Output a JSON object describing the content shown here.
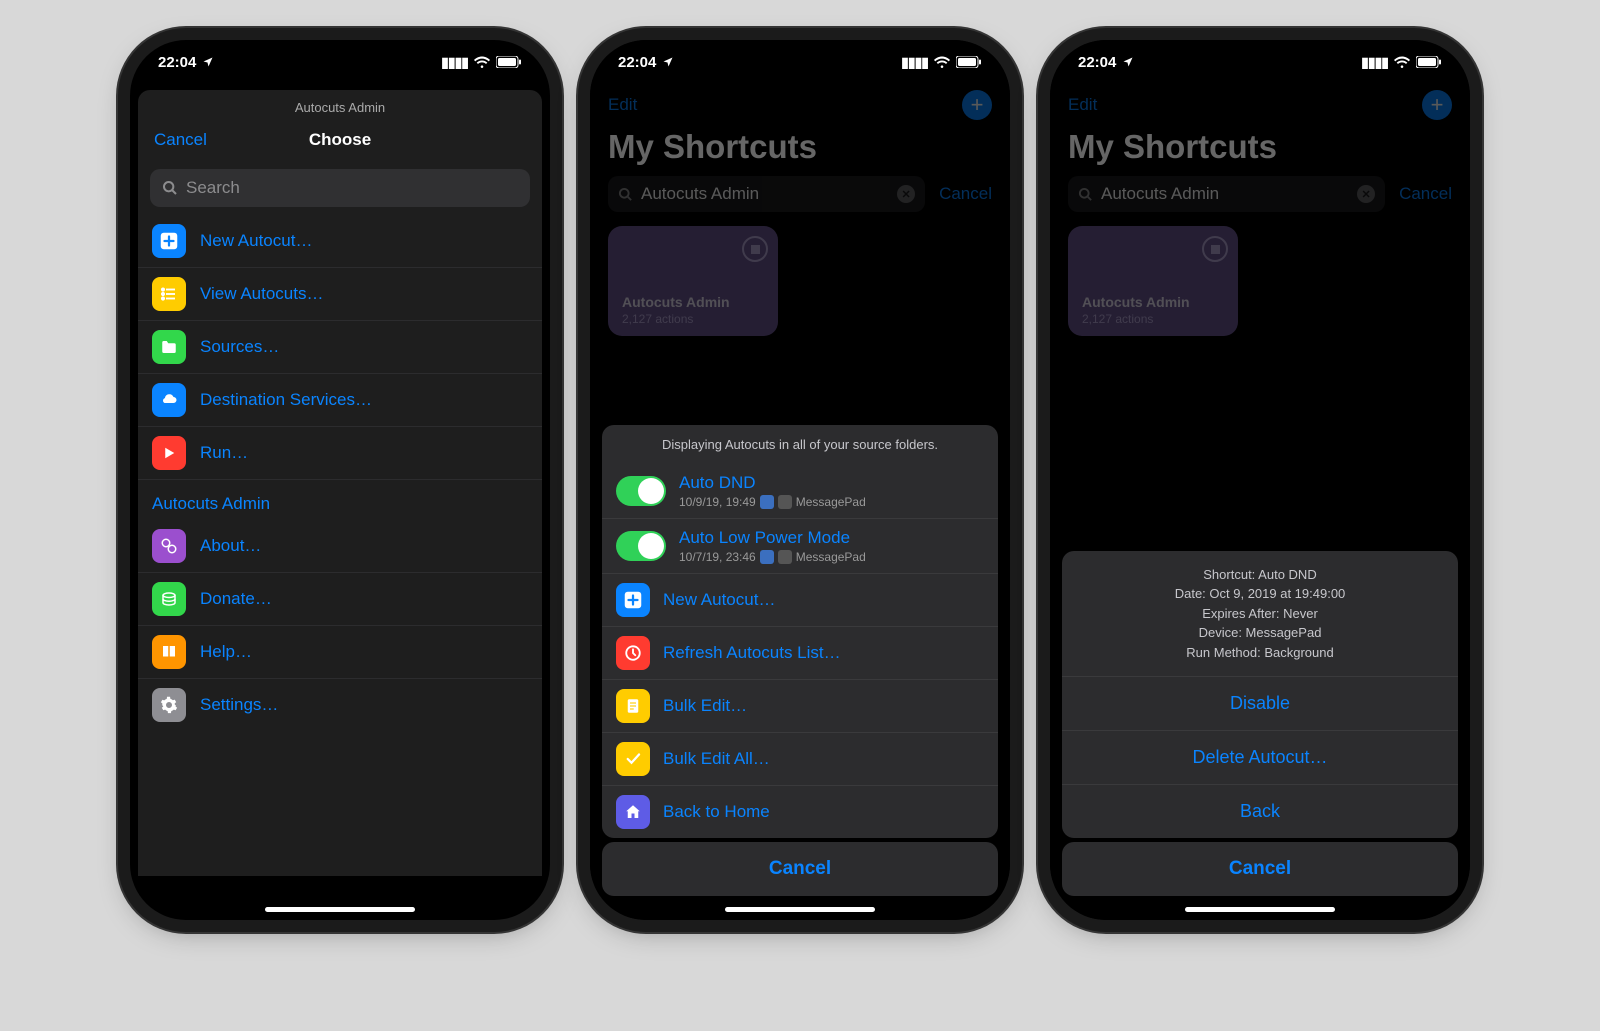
{
  "status": {
    "time": "22:04",
    "loc_icon": "loc",
    "signal": "••••",
    "wifi": "wifi",
    "battery": "bat"
  },
  "phone1": {
    "mini_title": "Autocuts Admin",
    "cancel": "Cancel",
    "choose": "Choose",
    "search_ph": "Search",
    "section1": [
      {
        "label": "New Autocut…",
        "bg": "#0a84ff",
        "name": "plus-icon"
      },
      {
        "label": "View Autocuts…",
        "bg": "#ffcc00",
        "name": "list-icon"
      },
      {
        "label": "Sources…",
        "bg": "#32d74b",
        "name": "folder-icon"
      },
      {
        "label": "Destination Services…",
        "bg": "#0a84ff",
        "name": "cloud-icon"
      },
      {
        "label": "Run…",
        "bg": "#ff3b30",
        "name": "play-icon"
      }
    ],
    "section2_hdr": "Autocuts Admin",
    "section2": [
      {
        "label": "About…",
        "bg": "#9b4fce",
        "name": "gears-icon"
      },
      {
        "label": "Donate…",
        "bg": "#32d74b",
        "name": "coins-icon"
      },
      {
        "label": "Help…",
        "bg": "#ff9500",
        "name": "book-icon"
      },
      {
        "label": "Settings…",
        "bg": "#8e8e93",
        "name": "gear-icon"
      }
    ]
  },
  "phone2": {
    "edit": "Edit",
    "title": "My Shortcuts",
    "search_val": "Autocuts Admin",
    "cancel": "Cancel",
    "card": {
      "title": "Autocuts Admin",
      "sub": "2,127 actions"
    },
    "panel_hdr": "Displaying Autocuts in all of your source folders.",
    "dnd": {
      "title": "Auto DND",
      "sub": "10/9/19, 19:49",
      "device": "MessagePad"
    },
    "lpm": {
      "title": "Auto Low Power Mode",
      "sub": "10/7/19, 23:46",
      "device": "MessagePad"
    },
    "actions": [
      {
        "label": "New Autocut…",
        "bg": "#0a84ff",
        "name": "plus-icon"
      },
      {
        "label": "Refresh Autocuts List…",
        "bg": "#ff3b30",
        "name": "refresh-icon"
      },
      {
        "label": "Bulk Edit…",
        "bg": "#ffcc00",
        "name": "note-icon"
      },
      {
        "label": "Bulk Edit All…",
        "bg": "#ffcc00",
        "name": "check-icon"
      },
      {
        "label": "Back to Home",
        "bg": "#5e5ce6",
        "name": "home-icon"
      }
    ],
    "big_cancel": "Cancel"
  },
  "phone3": {
    "edit": "Edit",
    "title": "My Shortcuts",
    "search_val": "Autocuts Admin",
    "cancel": "Cancel",
    "card": {
      "title": "Autocuts Admin",
      "sub": "2,127 actions"
    },
    "info": {
      "l1": "Shortcut: Auto DND",
      "l2": "Date: Oct 9, 2019 at 19:49:00",
      "l3": "Expires After: Never",
      "l4": "Device: MessagePad",
      "l5": "Run Method: Background"
    },
    "actions": {
      "disable": "Disable",
      "delete": "Delete Autocut…",
      "back": "Back"
    },
    "big_cancel": "Cancel"
  }
}
